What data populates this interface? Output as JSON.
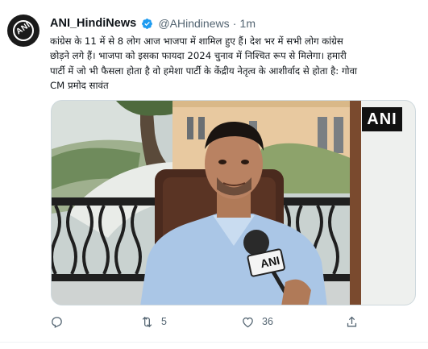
{
  "tweet": {
    "author": {
      "name": "ANI_HindiNews",
      "handle": "@AHindinews",
      "separator": "·",
      "time": "1m",
      "avatar_text": "ANI"
    },
    "text": "कांग्रेस के 11 में से 8 लोग आज भाजपा में शामिल हुए हैं। देश भर में सभी लोग कांग्रेस\nछोड़ने लगे हैं। भाजपा को इसका फायदा 2024 चुनाव में निश्चित रूप से मिलेगा। हमारी\nपार्टी में जो भी फैसला होता है वो हमेशा पार्टी के केंद्रीय नेतृत्व के आशीर्वाद से होता है: गोवा\nCM प्रमोद सावंत",
    "media": {
      "watermark": "ANI",
      "mic_label": "ANI"
    },
    "actions": {
      "reply_count": "",
      "retweet_count": "5",
      "like_count": "36"
    },
    "icons": [
      "verified-badge-icon",
      "more-icon",
      "reply-icon",
      "retweet-icon",
      "like-icon",
      "share-icon"
    ],
    "colors": {
      "verified": "#1d9bf0",
      "muted": "#536471",
      "text": "#0f1419"
    }
  }
}
